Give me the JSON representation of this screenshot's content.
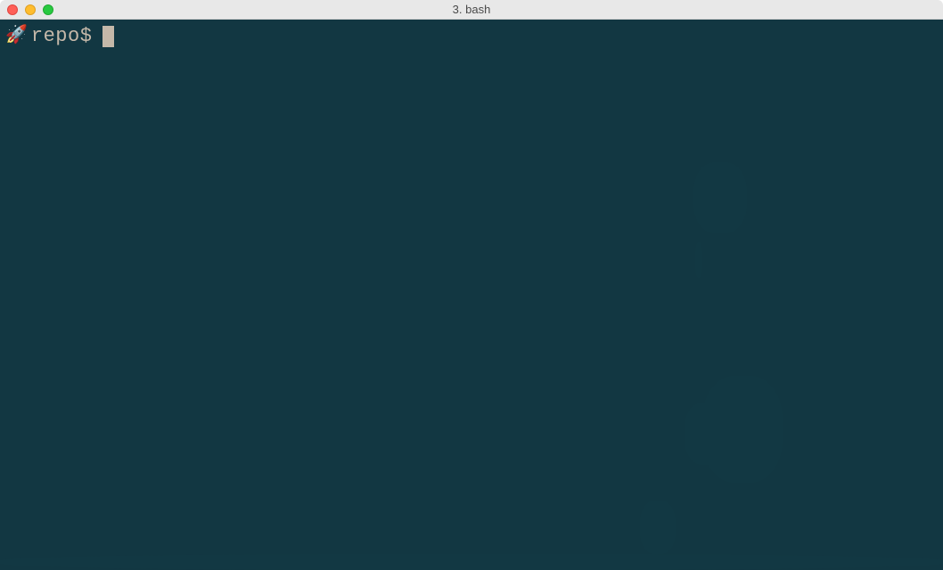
{
  "window": {
    "title": "3. bash"
  },
  "terminal": {
    "prompt_icon": "🚀",
    "prompt_text": "repo$",
    "cursor_char": " "
  }
}
